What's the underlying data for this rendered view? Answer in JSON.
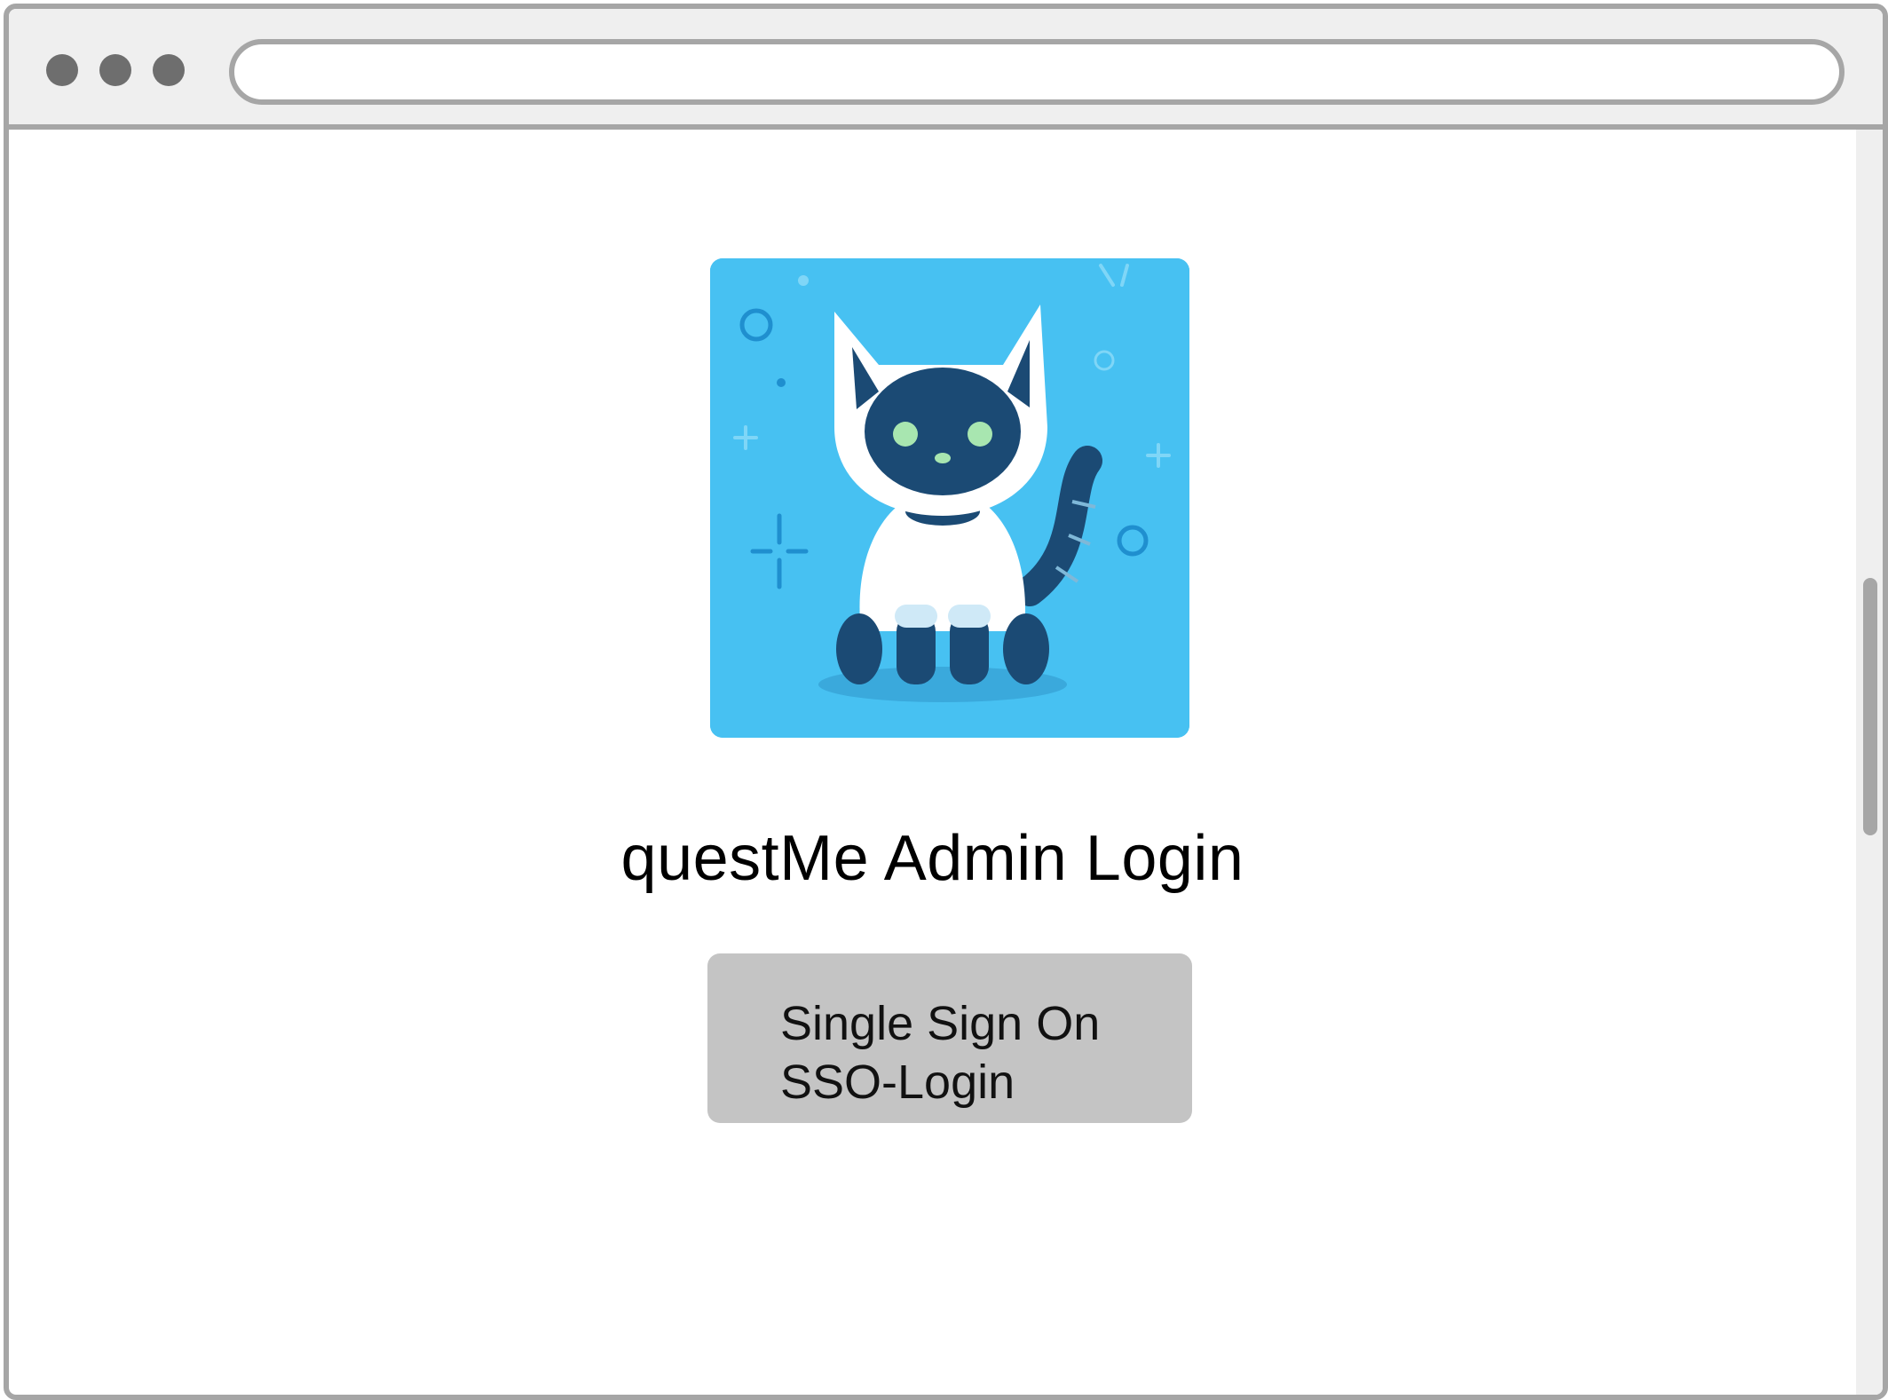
{
  "browser": {
    "address_bar_value": ""
  },
  "main": {
    "hero_image_alt": "Robot cat illustration",
    "title": "questMe Admin Login",
    "sso_button": {
      "line1": "Single Sign On",
      "line2": "SSO-Login"
    }
  },
  "icons": {
    "window_controls": [
      "window-dot-icon",
      "window-dot-icon",
      "window-dot-icon"
    ],
    "hero": "robot-cat-icon"
  },
  "colors": {
    "hero_background": "#47c1f2",
    "cat_dark": "#1b4a74",
    "cat_white": "#ffffff",
    "cat_eyes": "#a8e6b0",
    "button_background": "#c4c4c4",
    "window_frame": "#a6a6a6"
  }
}
